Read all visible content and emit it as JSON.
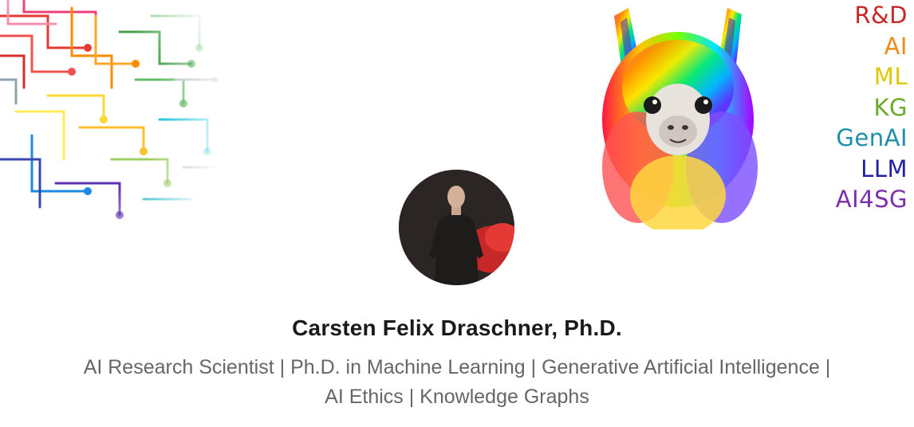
{
  "profile": {
    "name": "Carsten Felix Draschner, Ph.D.",
    "headline": "AI Research Scientist | Ph.D. in Machine Learning | Generative Artificial Intelligence | AI Ethics | Knowledge Graphs"
  },
  "banner": {
    "left_art_icon": "rainbow-circuit-brain",
    "right_art_icon": "rainbow-llama",
    "tags": [
      {
        "label": "R&D",
        "color": "#c62828"
      },
      {
        "label": "AI",
        "color": "#ef8a17"
      },
      {
        "label": "ML",
        "color": "#e2c600"
      },
      {
        "label": "KG",
        "color": "#6aaa2a"
      },
      {
        "label": "GenAI",
        "color": "#1e8fa8"
      },
      {
        "label": "LLM",
        "color": "#1f1fa8"
      },
      {
        "label": "AI4SG",
        "color": "#7b2fa8"
      }
    ]
  },
  "avatar_icon": "profile-photo"
}
